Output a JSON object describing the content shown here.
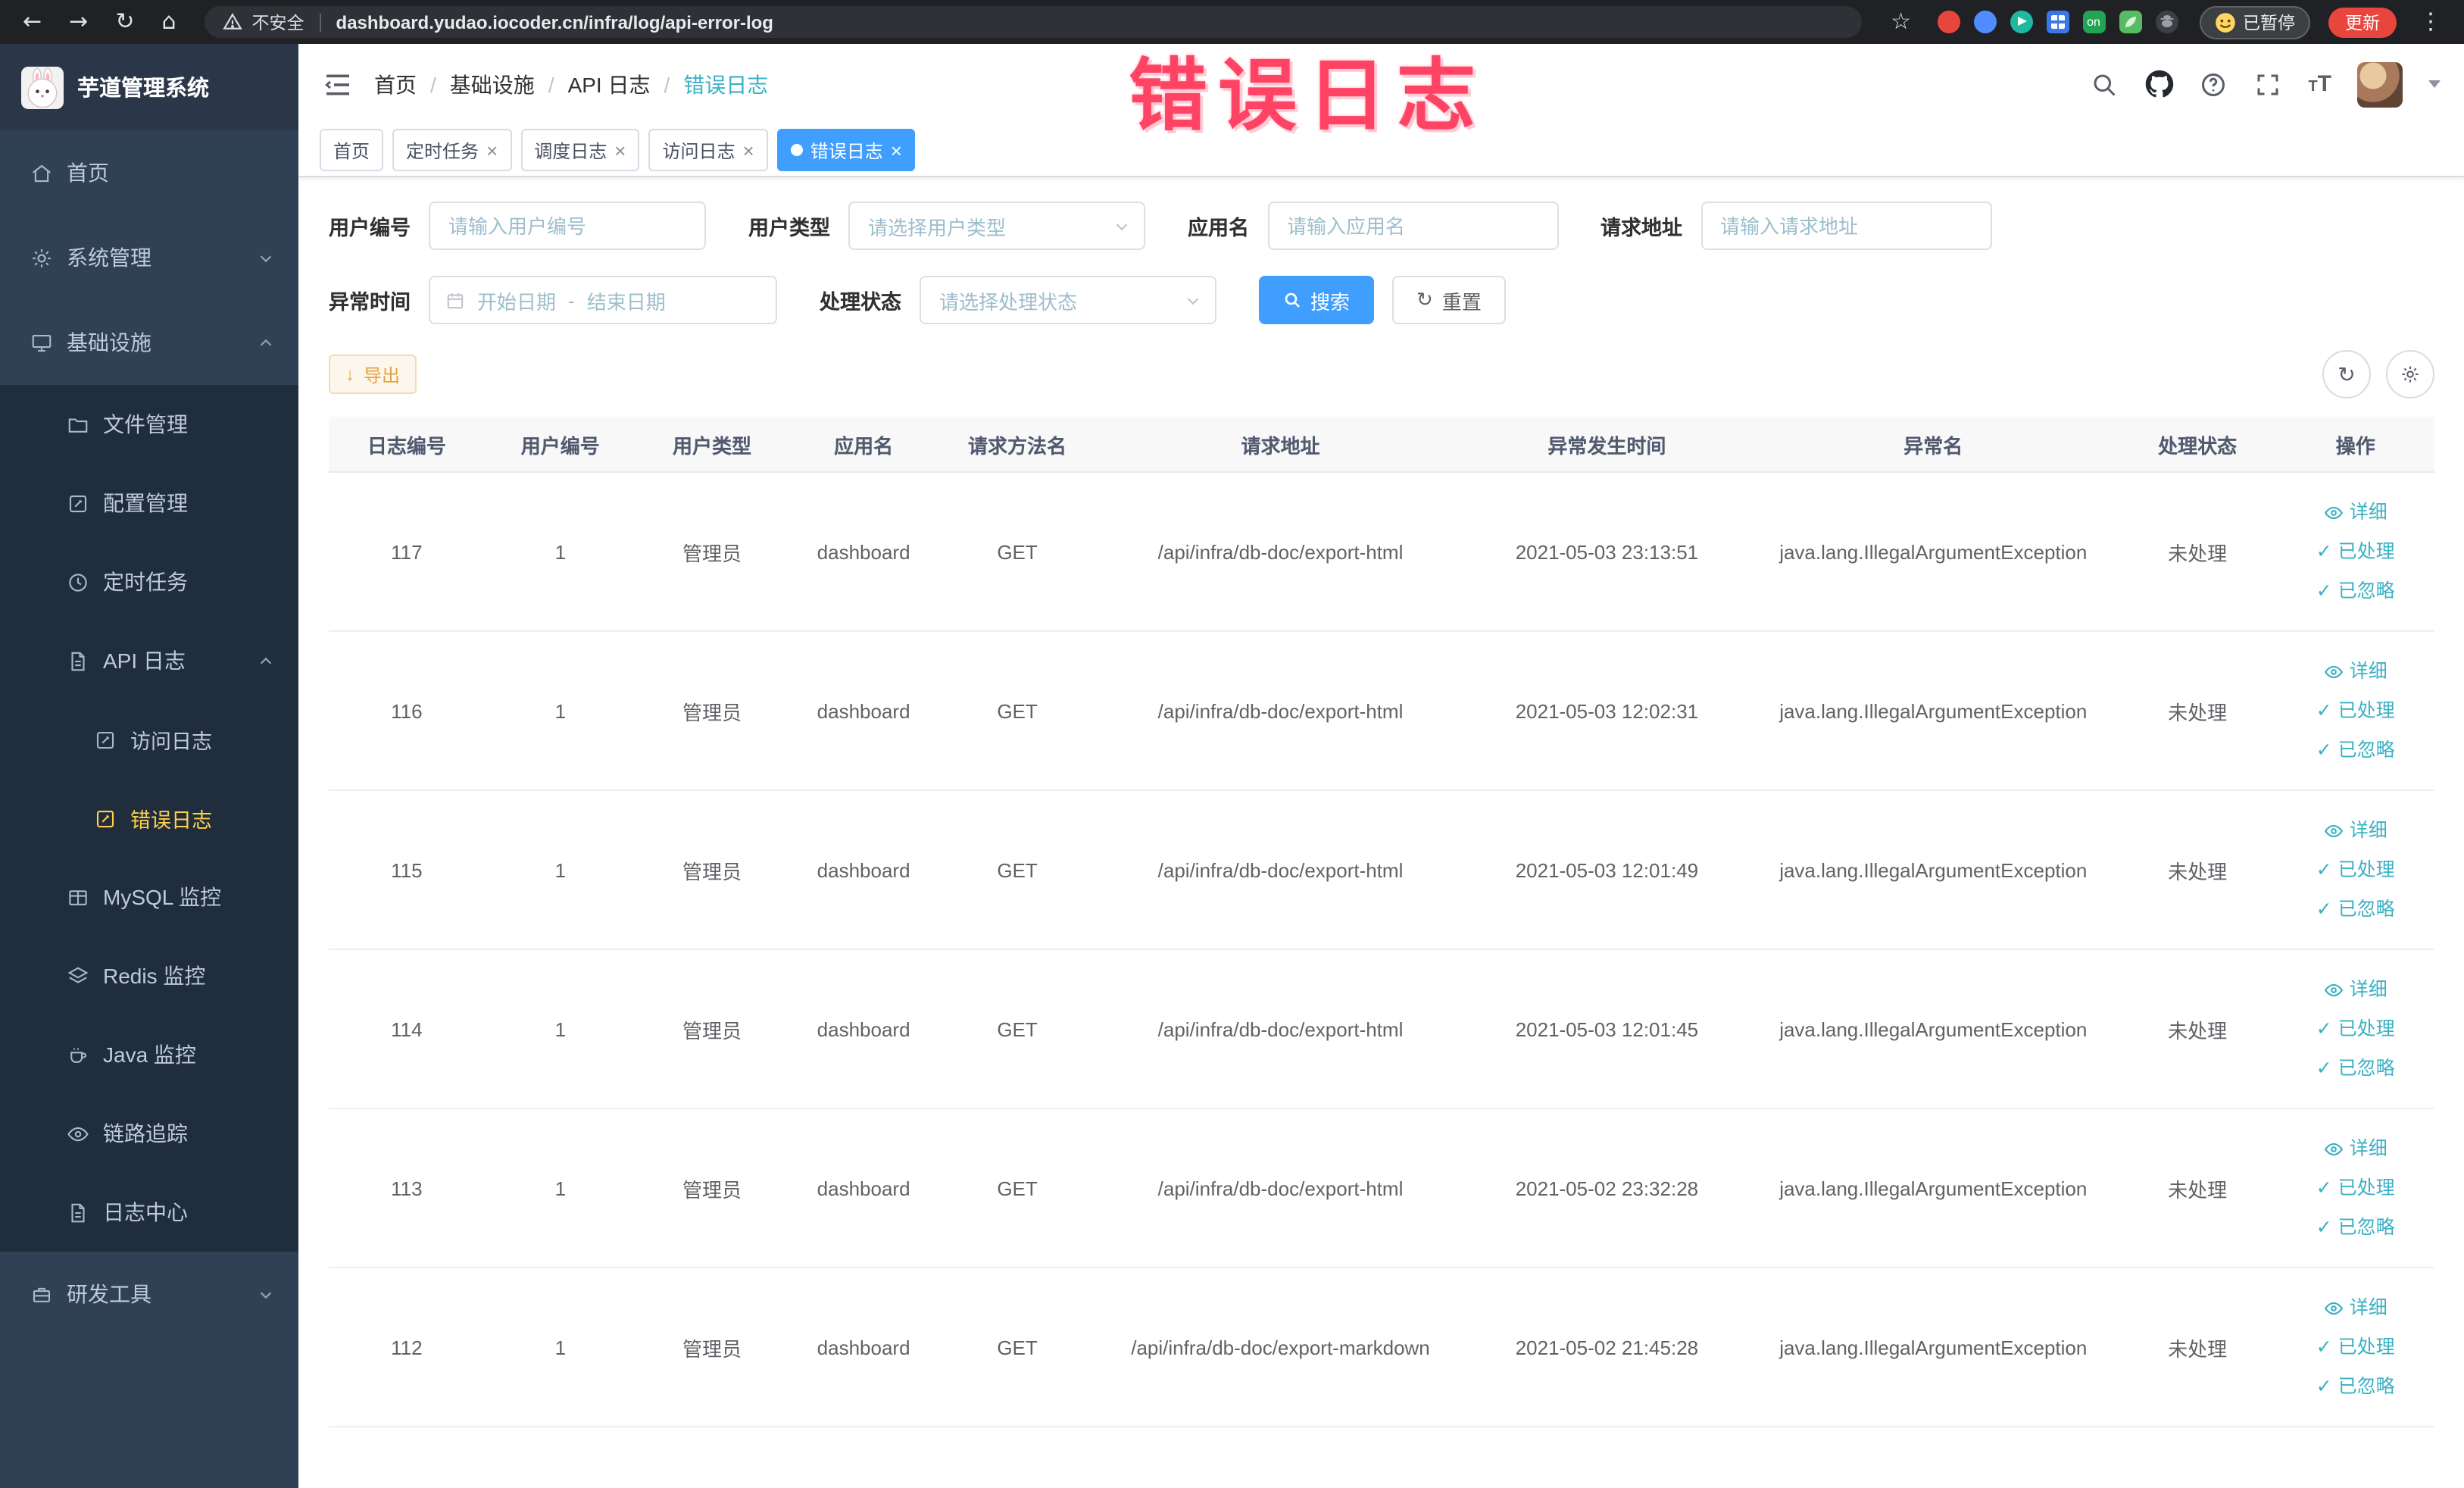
{
  "browser": {
    "security_label": "不安全",
    "url": "dashboard.yudao.iocoder.cn/infra/log/api-error-log",
    "on_badge": "on",
    "paused_label": "已暂停",
    "update_label": "更新"
  },
  "sidebar": {
    "logo_title": "芋道管理系统",
    "items": [
      {
        "label": "首页",
        "icon": "home-icon"
      },
      {
        "label": "系统管理",
        "icon": "gear-icon"
      },
      {
        "label": "基础设施",
        "icon": "monitor-icon"
      },
      {
        "label": "文件管理",
        "icon": "folder-icon"
      },
      {
        "label": "配置管理",
        "icon": "edit-icon"
      },
      {
        "label": "定时任务",
        "icon": "clock-icon"
      },
      {
        "label": "API 日志",
        "icon": "document-icon"
      },
      {
        "label": "访问日志",
        "icon": "edit-icon"
      },
      {
        "label": "错误日志",
        "icon": "edit-icon"
      },
      {
        "label": "MySQL 监控",
        "icon": "table-grid-icon"
      },
      {
        "label": "Redis 监控",
        "icon": "layers-icon"
      },
      {
        "label": "Java 监控",
        "icon": "coffee-icon"
      },
      {
        "label": "链路追踪",
        "icon": "eye-icon"
      },
      {
        "label": "日志中心",
        "icon": "document-icon"
      },
      {
        "label": "研发工具",
        "icon": "toolbox-icon"
      }
    ]
  },
  "navbar": {
    "breadcrumb": [
      "首页",
      "基础设施",
      "API 日志",
      "错误日志"
    ]
  },
  "annotation": {
    "text": "错误日志",
    "color": "#ff4365"
  },
  "tags": [
    "首页",
    "定时任务",
    "调度日志",
    "访问日志",
    "错误日志"
  ],
  "filters": {
    "user_id": {
      "label": "用户编号",
      "placeholder": "请输入用户编号"
    },
    "user_type": {
      "label": "用户类型",
      "placeholder": "请选择用户类型"
    },
    "app_name": {
      "label": "应用名",
      "placeholder": "请输入应用名"
    },
    "request_url": {
      "label": "请求地址",
      "placeholder": "请输入请求地址"
    },
    "exception_time": {
      "label": "异常时间",
      "start_placeholder": "开始日期",
      "separator": "-",
      "end_placeholder": "结束日期"
    },
    "process_status": {
      "label": "处理状态",
      "placeholder": "请选择处理状态"
    },
    "search_label": "搜索",
    "reset_label": "重置"
  },
  "toolbar": {
    "export_label": "导出"
  },
  "table": {
    "columns": [
      "日志编号",
      "用户编号",
      "用户类型",
      "应用名",
      "请求方法名",
      "请求地址",
      "异常发生时间",
      "异常名",
      "处理状态",
      "操作"
    ],
    "actions": {
      "detail": "详细",
      "processed": "已处理",
      "ignored": "已忽略"
    },
    "rows": [
      {
        "log_id": "117",
        "user_id": "1",
        "user_type": "管理员",
        "app_name": "dashboard",
        "method": "GET",
        "url": "/api/infra/db-doc/export-html",
        "time": "2021-05-03 23:13:51",
        "exception": "java.lang.IllegalArgumentException",
        "status": "未处理"
      },
      {
        "log_id": "116",
        "user_id": "1",
        "user_type": "管理员",
        "app_name": "dashboard",
        "method": "GET",
        "url": "/api/infra/db-doc/export-html",
        "time": "2021-05-03 12:02:31",
        "exception": "java.lang.IllegalArgumentException",
        "status": "未处理"
      },
      {
        "log_id": "115",
        "user_id": "1",
        "user_type": "管理员",
        "app_name": "dashboard",
        "method": "GET",
        "url": "/api/infra/db-doc/export-html",
        "time": "2021-05-03 12:01:49",
        "exception": "java.lang.IllegalArgumentException",
        "status": "未处理"
      },
      {
        "log_id": "114",
        "user_id": "1",
        "user_type": "管理员",
        "app_name": "dashboard",
        "method": "GET",
        "url": "/api/infra/db-doc/export-html",
        "time": "2021-05-03 12:01:45",
        "exception": "java.lang.IllegalArgumentException",
        "status": "未处理"
      },
      {
        "log_id": "113",
        "user_id": "1",
        "user_type": "管理员",
        "app_name": "dashboard",
        "method": "GET",
        "url": "/api/infra/db-doc/export-html",
        "time": "2021-05-02 23:32:28",
        "exception": "java.lang.IllegalArgumentException",
        "status": "未处理"
      },
      {
        "log_id": "112",
        "user_id": "1",
        "user_type": "管理员",
        "app_name": "dashboard",
        "method": "GET",
        "url": "/api/infra/db-doc/export-markdown",
        "time": "2021-05-02 21:45:28",
        "exception": "java.lang.IllegalArgumentException",
        "status": "未处理"
      }
    ]
  },
  "colors": {
    "primary": "#409EFF",
    "link_teal": "#3bb1c4",
    "active_menu": "#ffd04b",
    "warning": "#e6a23c"
  }
}
